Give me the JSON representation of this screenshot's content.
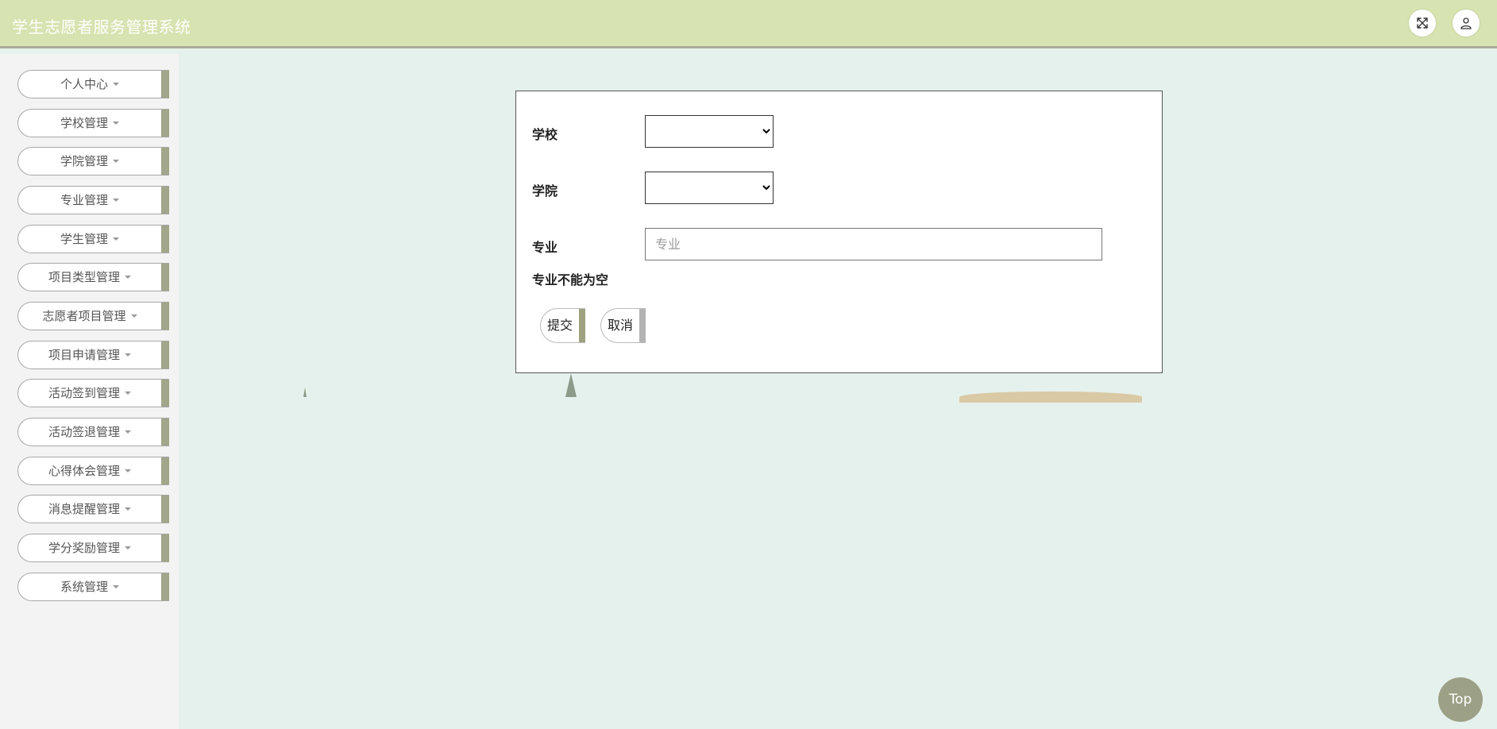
{
  "header": {
    "title": "学生志愿者服务管理系统",
    "fullscreen_icon": "fullscreen-icon",
    "user_icon": "user-icon"
  },
  "sidebar": {
    "items": [
      {
        "label": "个人中心"
      },
      {
        "label": "学校管理"
      },
      {
        "label": "学院管理"
      },
      {
        "label": "专业管理"
      },
      {
        "label": "学生管理"
      },
      {
        "label": "项目类型管理"
      },
      {
        "label": "志愿者项目管理"
      },
      {
        "label": "项目申请管理"
      },
      {
        "label": "活动签到管理"
      },
      {
        "label": "活动签退管理"
      },
      {
        "label": "心得体会管理"
      },
      {
        "label": "消息提醒管理"
      },
      {
        "label": "学分奖励管理"
      },
      {
        "label": "系统管理"
      }
    ]
  },
  "form": {
    "school": {
      "label": "学校",
      "value": ""
    },
    "college": {
      "label": "学院",
      "value": ""
    },
    "major": {
      "label": "专业",
      "value": "",
      "placeholder": "专业",
      "error": "专业不能为空"
    },
    "submit_label": "提交",
    "cancel_label": "取消"
  },
  "back_to_top": {
    "label": "Top"
  },
  "colors": {
    "header_bg": "#d7e3b0",
    "page_bg": "#e5f1ec",
    "sidebar_bg": "#f3f3f3",
    "accent_olive": "#a2a68a",
    "submit_bar": "#9ea27f",
    "cancel_bar": "#b3b3b3",
    "top_button": "#9ca086"
  }
}
